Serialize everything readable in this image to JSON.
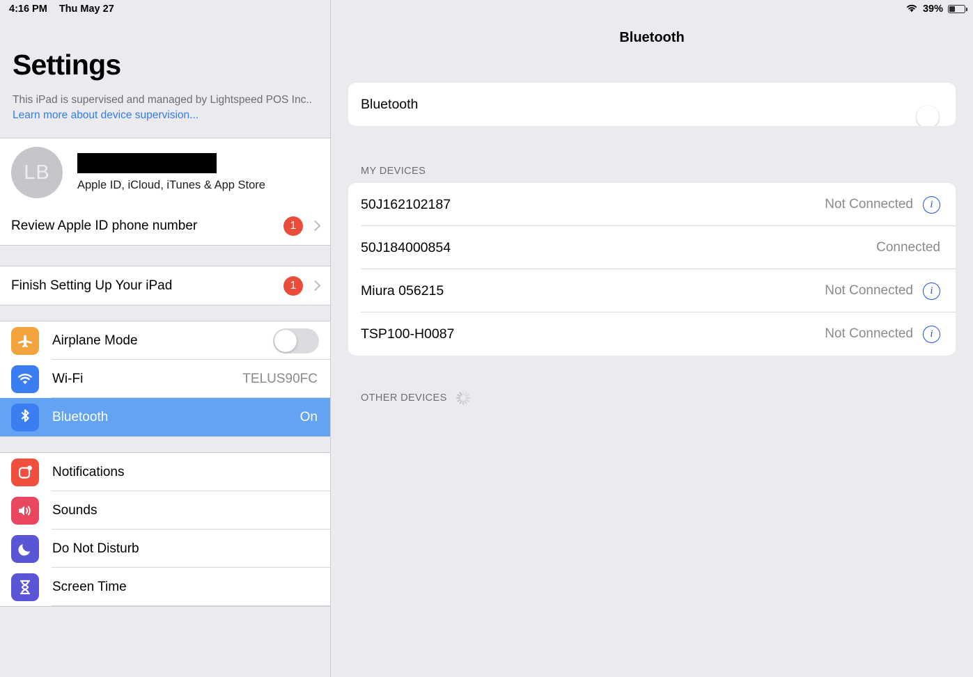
{
  "statusbar": {
    "time": "4:16 PM",
    "date": "Thu May 27",
    "wifi_icon": "wifi-icon",
    "battery_percent": "39%",
    "battery_level": 39
  },
  "sidebar": {
    "title": "Settings",
    "supervision_text": "This iPad is supervised and managed by Lightspeed POS Inc.. ",
    "supervision_link": "Learn more about device supervision...",
    "account": {
      "initials": "LB",
      "name_redacted": true,
      "subtitle": "Apple ID, iCloud, iTunes & App Store"
    },
    "review_row": {
      "label": "Review Apple ID phone number",
      "badge": "1",
      "chevron_icon": "chevron-right-icon"
    },
    "finish_row": {
      "label": "Finish Setting Up Your iPad",
      "badge": "1",
      "chevron_icon": "chevron-right-icon"
    },
    "items": [
      {
        "label": "Airplane Mode",
        "icon": "airplane-icon",
        "toggle": "off",
        "value": ""
      },
      {
        "label": "Wi-Fi",
        "icon": "wifi-icon",
        "value": "TELUS90FC"
      },
      {
        "label": "Bluetooth",
        "icon": "bluetooth-icon",
        "value": "On",
        "selected": true
      },
      {
        "label": "Notifications",
        "icon": "notifications-icon",
        "value": ""
      },
      {
        "label": "Sounds",
        "icon": "sounds-icon",
        "value": ""
      },
      {
        "label": "Do Not Disturb",
        "icon": "moon-icon",
        "value": ""
      },
      {
        "label": "Screen Time",
        "icon": "hourglass-icon",
        "value": ""
      }
    ]
  },
  "detail": {
    "title": "Bluetooth",
    "bluetooth_toggle": {
      "label": "Bluetooth",
      "state": "on"
    },
    "my_devices_header": "MY DEVICES",
    "other_devices_header": "OTHER DEVICES",
    "spinner_icon": "loading-spinner-icon",
    "devices": [
      {
        "name": "50J162102187",
        "status": "Not Connected",
        "info": true
      },
      {
        "name": "50J184000854",
        "status": "Connected",
        "info": false
      },
      {
        "name": "Miura 056215",
        "status": "Not Connected",
        "info": true
      },
      {
        "name": "TSP100-H0087",
        "status": "Not Connected",
        "info": true
      }
    ]
  },
  "colors": {
    "selection_blue": "#64a2f4",
    "toggle_on_green": "#4cd264",
    "badge_red": "#eb4b39",
    "link_blue": "#2f7cf6",
    "info_blue": "#1e51e8",
    "background": "#ebeaef"
  }
}
